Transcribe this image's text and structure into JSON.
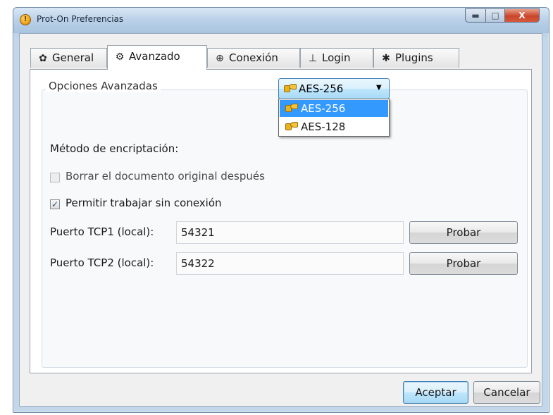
{
  "window": {
    "title": "Prot-On Preferencias",
    "controls": {
      "minimize_icon": "minimize-icon",
      "maximize_icon": "maximize-icon",
      "close_icon": "close-icon",
      "minimize_glyph": "▬",
      "maximize_glyph": "□",
      "close_glyph": "X"
    }
  },
  "tabs": [
    {
      "label": "General",
      "icon": "gear-icon",
      "glyph": "✿"
    },
    {
      "label": "Avanzado",
      "icon": "advanced-gear-icon",
      "glyph": "⚙"
    },
    {
      "label": "Conexión",
      "icon": "globe-icon",
      "glyph": "⊕"
    },
    {
      "label": "Login",
      "icon": "user-icon",
      "glyph": "⊥"
    },
    {
      "label": "Plugins",
      "icon": "plugins-icon",
      "glyph": "✱"
    }
  ],
  "active_tab": "Avanzado",
  "advanced": {
    "group_title": "Opciones Avanzadas",
    "encryption_label": "Método de encriptación:",
    "encryption_selected": "AES-256",
    "encryption_options": [
      "AES-256",
      "AES-128"
    ],
    "delete_original_label": "Borrar el documento original después",
    "delete_original_checked": false,
    "offline_label": "Permitir trabajar sin conexión",
    "offline_checked": true,
    "tcp1_label": "Puerto TCP1 (local):",
    "tcp1_value": "54321",
    "tcp2_label": "Puerto TCP2 (local):",
    "tcp2_value": "54322",
    "probar_label": "Probar"
  },
  "footer": {
    "accept_label": "Aceptar",
    "cancel_label": "Cancelar"
  },
  "colors": {
    "selection": "#3399ff",
    "close_button": "#c9452b",
    "default_button_border": "#3c7fb1"
  }
}
